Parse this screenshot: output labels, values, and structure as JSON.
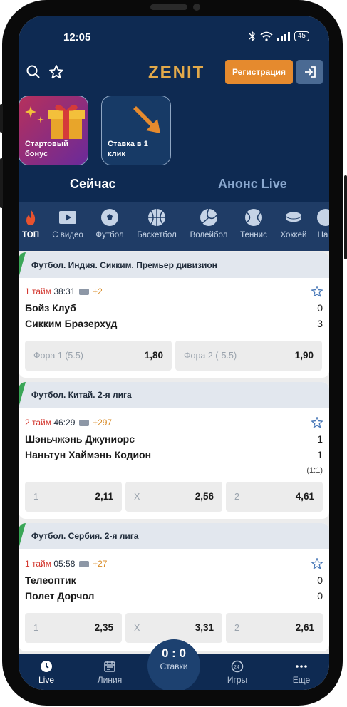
{
  "status": {
    "time": "12:05",
    "battery": "45"
  },
  "header": {
    "logo": "ZENIT",
    "register_label": "Регистрация"
  },
  "promos": [
    {
      "label_line1": "Стартовый",
      "label_line2": "бонус"
    },
    {
      "label_line1": "Ставка в 1",
      "label_line2": "клик"
    }
  ],
  "mode_tabs": [
    {
      "label": "Сейчас",
      "active": true
    },
    {
      "label": "Анонс Live",
      "active": false
    }
  ],
  "sports": [
    {
      "label": "ТОП",
      "icon": "fire-icon"
    },
    {
      "label": "С видео",
      "icon": "video-icon"
    },
    {
      "label": "Футбол",
      "icon": "football-icon"
    },
    {
      "label": "Баскетбол",
      "icon": "basketball-icon"
    },
    {
      "label": "Волейбол",
      "icon": "volleyball-icon"
    },
    {
      "label": "Теннис",
      "icon": "tennis-icon"
    },
    {
      "label": "Хоккей",
      "icon": "hockey-icon"
    },
    {
      "label": "На",
      "icon": "more-sport-icon"
    }
  ],
  "events": [
    {
      "league": "Футбол. Индия. Сикким. Премьер дивизион",
      "period": "1 тайм",
      "clock": "38:31",
      "markets_more": "+2",
      "team1": "Бойз Клуб",
      "team2": "Сикким Бразерхуд",
      "score1": "0",
      "score2": "3",
      "odds": [
        {
          "label": "Фора 1 (5.5)",
          "value": "1,80"
        },
        {
          "label": "Фора 2 (-5.5)",
          "value": "1,90"
        }
      ]
    },
    {
      "league": "Футбол. Китай. 2-я лига",
      "period": "2 тайм",
      "clock": "46:29",
      "markets_more": "+297",
      "team1": "Шэньчжэнь Джуниорс",
      "team2": "Наньтун Хаймэнь Кодион",
      "score1": "1",
      "score2": "1",
      "half_score": "(1:1)",
      "odds": [
        {
          "label": "1",
          "value": "2,11"
        },
        {
          "label": "X",
          "value": "2,56"
        },
        {
          "label": "2",
          "value": "4,61"
        }
      ]
    },
    {
      "league": "Футбол. Сербия. 2-я лига",
      "period": "1 тайм",
      "clock": "05:58",
      "markets_more": "+27",
      "team1": "Телеоптик",
      "team2": "Полет Дорчол",
      "score1": "0",
      "score2": "0",
      "odds": [
        {
          "label": "1",
          "value": "2,35"
        },
        {
          "label": "X",
          "value": "3,31"
        },
        {
          "label": "2",
          "value": "2,61"
        }
      ]
    }
  ],
  "bottom_nav": {
    "items": [
      {
        "label": "Live",
        "icon": "clock-icon"
      },
      {
        "label": "Линия",
        "icon": "calendar-icon"
      },
      {
        "label": "Игры",
        "icon": "games-24-7-icon"
      },
      {
        "label": "Еще",
        "icon": "more-icon"
      }
    ],
    "bets_score": "0 : 0",
    "bets_label": "Ставки"
  },
  "colors": {
    "header_bg": "#0e2a52",
    "accent_orange": "#e58a2e",
    "logo_gold": "#e2a94a",
    "live_red": "#d3382f",
    "stripe_green": "#3aa657"
  }
}
